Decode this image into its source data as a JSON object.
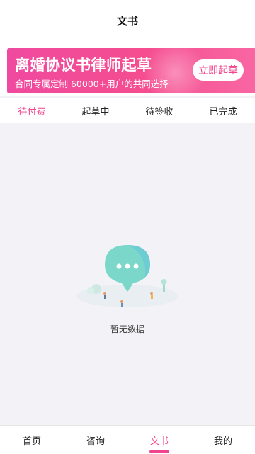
{
  "header": {
    "title": "文书"
  },
  "banner": {
    "headline": "离婚协议书律师起草",
    "subline": "合同专属定制  60000+用户的共同选择",
    "cta": "立即起草"
  },
  "tabs": [
    {
      "label": "待付费",
      "active": true
    },
    {
      "label": "起草中",
      "active": false
    },
    {
      "label": "待签收",
      "active": false
    },
    {
      "label": "已完成",
      "active": false
    }
  ],
  "empty_state": {
    "text": "暂无数据",
    "illustration": "chat-bubble-illustration"
  },
  "bottom_nav": [
    {
      "label": "首页",
      "active": false
    },
    {
      "label": "咨询",
      "active": false
    },
    {
      "label": "文书",
      "active": true
    },
    {
      "label": "我的",
      "active": false
    }
  ],
  "colors": {
    "accent": "#f0448e",
    "banner_start": "#f04aa0",
    "banner_end": "#f867a3",
    "bubble": "#7bd7c9"
  }
}
